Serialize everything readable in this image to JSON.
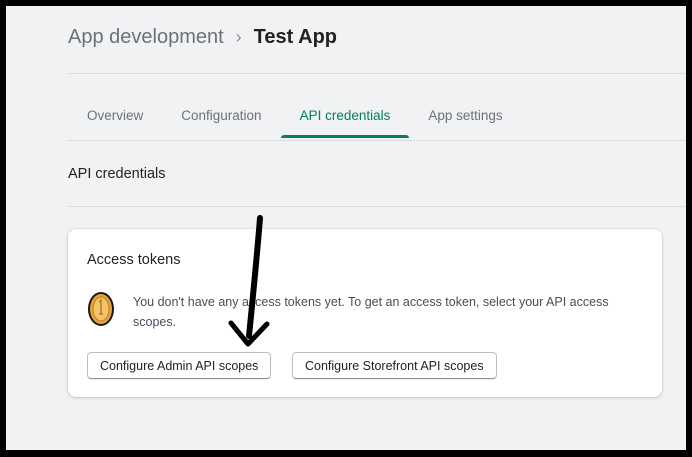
{
  "breadcrumb": {
    "parent": "App development",
    "separator": "›",
    "current": "Test App"
  },
  "tabs": [
    {
      "label": "Overview",
      "active": false
    },
    {
      "label": "Configuration",
      "active": false
    },
    {
      "label": "API credentials",
      "active": true
    },
    {
      "label": "App settings",
      "active": false
    }
  ],
  "section": {
    "title": "API credentials"
  },
  "access_tokens": {
    "title": "Access tokens",
    "banner_icon": "coin-icon",
    "message": "You don't have any access tokens yet. To get an access token, select your API access scopes.",
    "buttons": {
      "admin": "Configure Admin API scopes",
      "storefront": "Configure Storefront API scopes"
    }
  },
  "colors": {
    "accent": "#008060",
    "background": "#f1f2f4",
    "coin": "#e8a33c"
  }
}
